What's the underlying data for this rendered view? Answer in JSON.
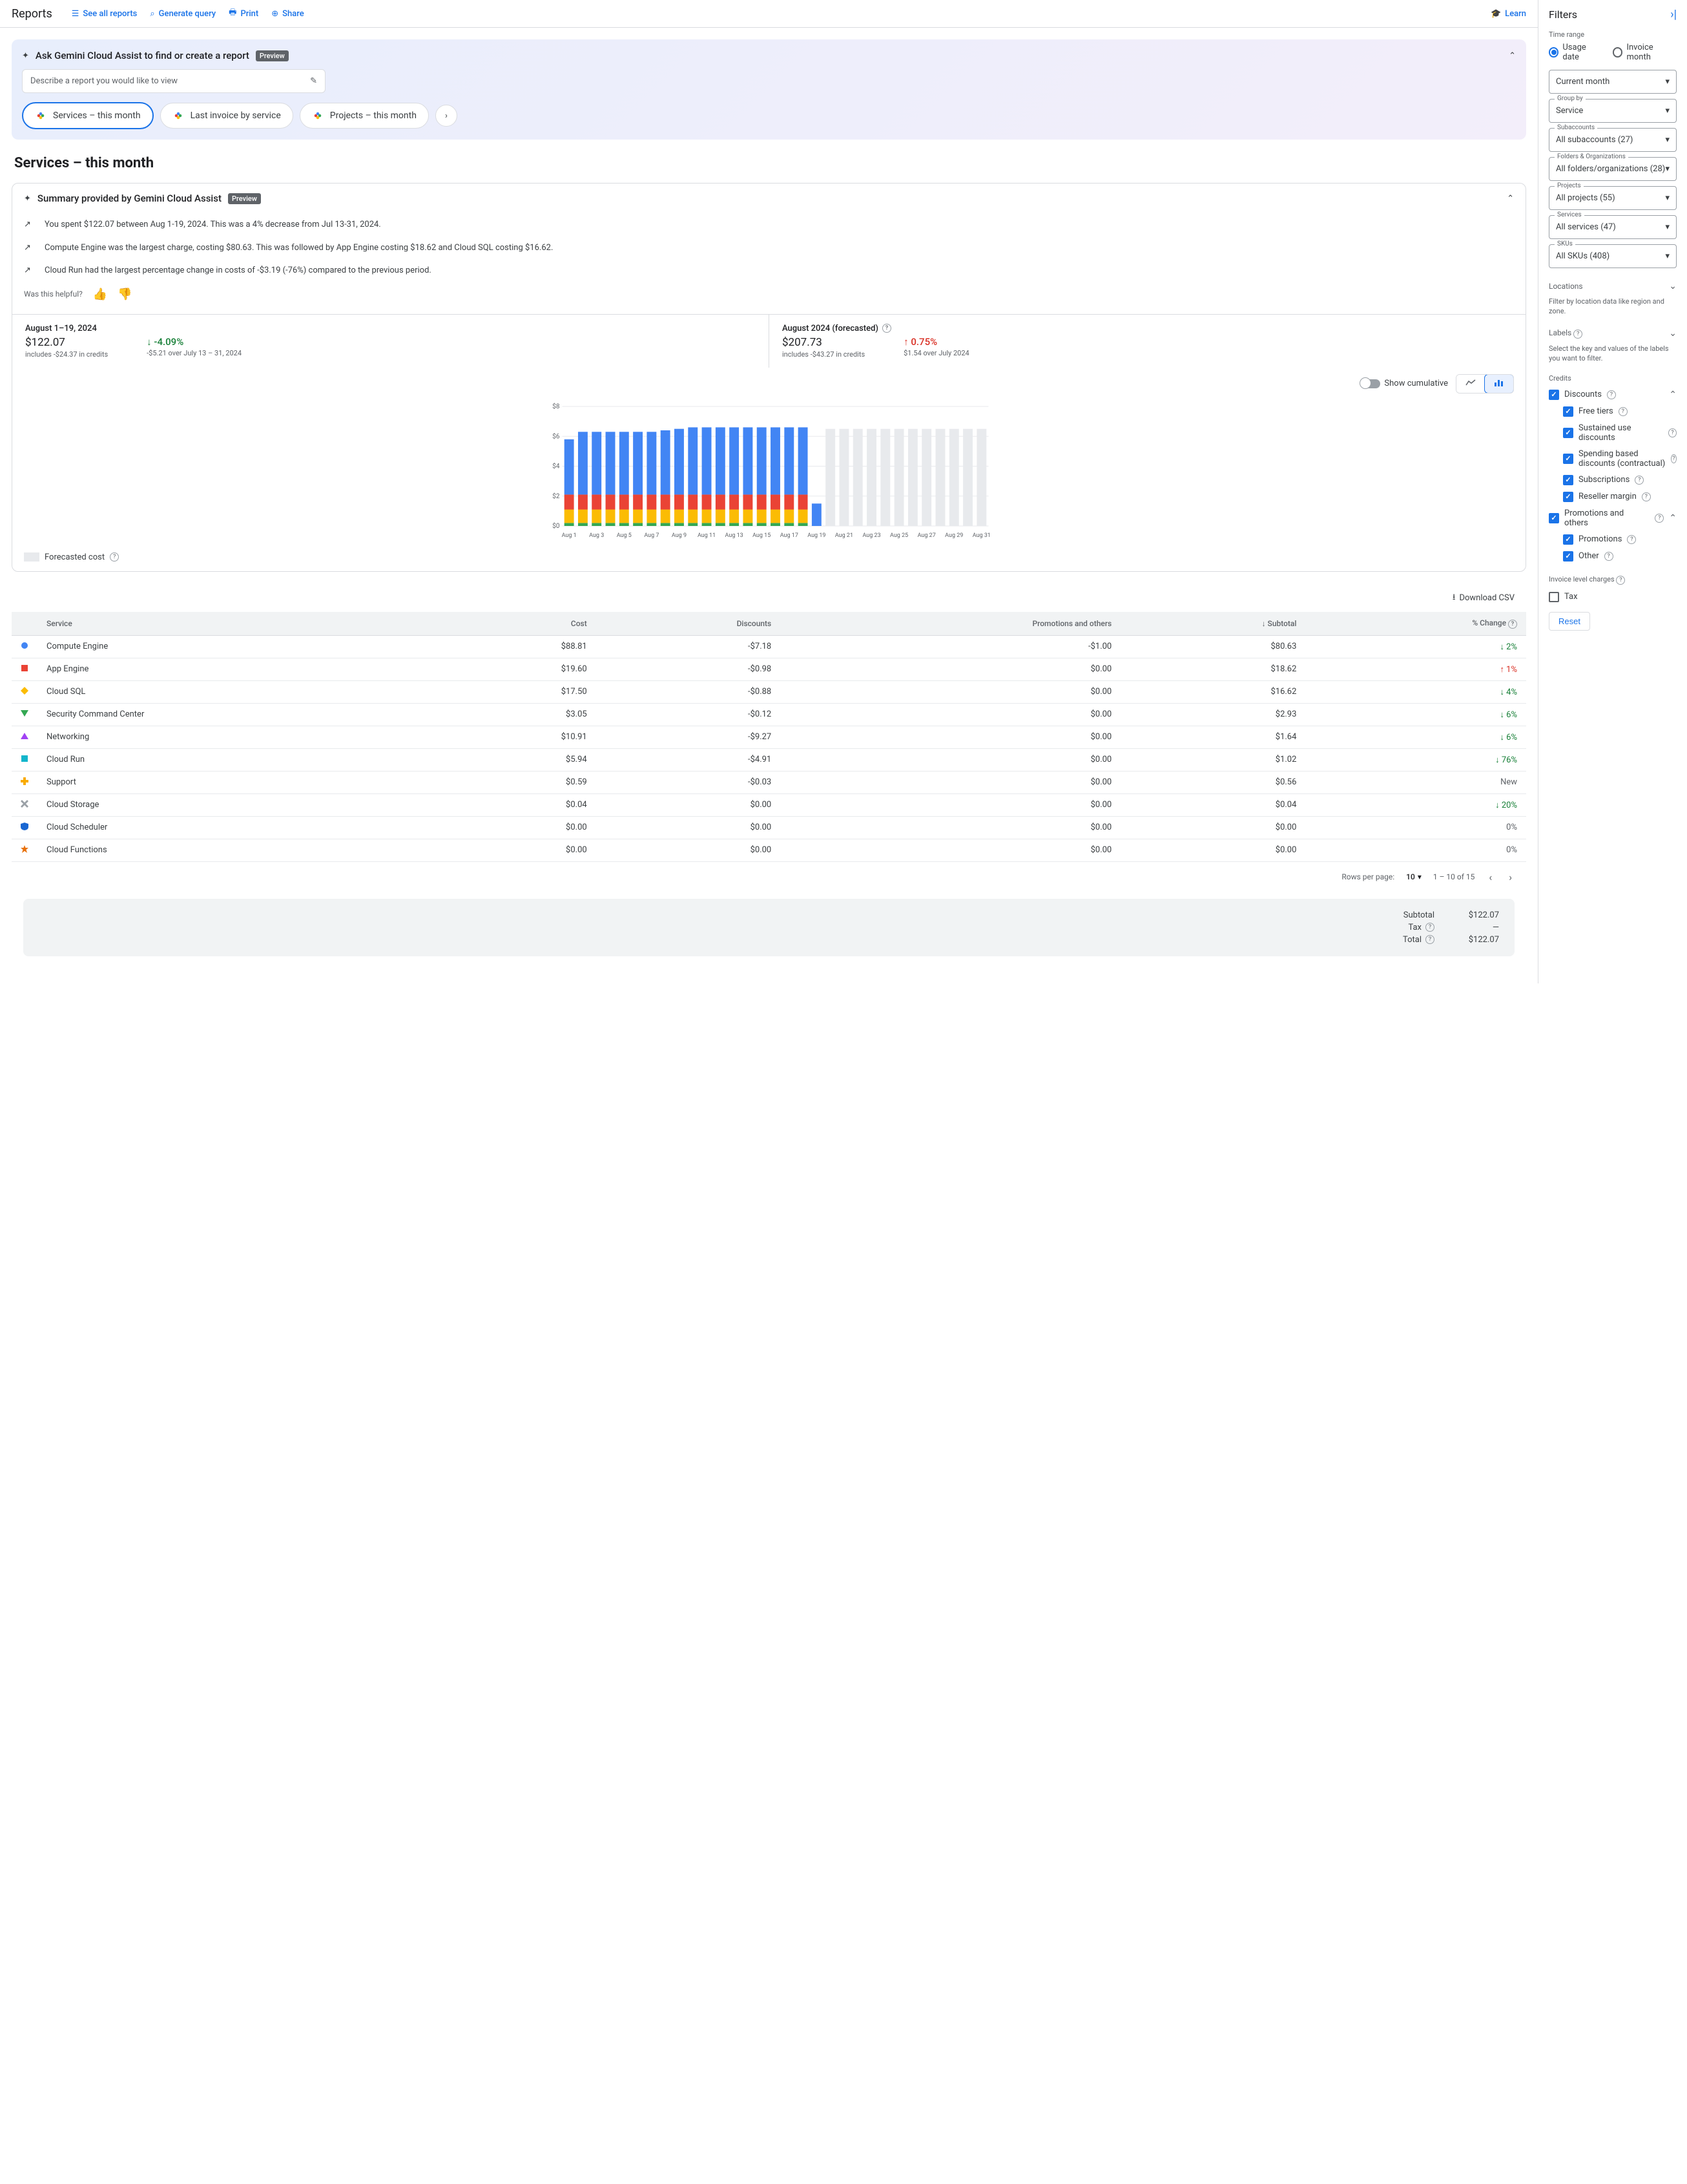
{
  "header": {
    "title": "Reports",
    "links": {
      "see_all": "See all reports",
      "generate": "Generate query",
      "print": "Print",
      "share": "Share",
      "learn": "Learn"
    }
  },
  "gemini": {
    "title": "Ask Gemini Cloud Assist to find or create a report",
    "badge": "Preview",
    "placeholder": "Describe a report you would like to view",
    "chips": [
      "Services – this month",
      "Last invoice by service",
      "Projects – this month"
    ]
  },
  "report": {
    "title": "Services – this month"
  },
  "summary": {
    "title": "Summary provided by Gemini Cloud Assist",
    "badge": "Preview",
    "items": [
      "You spent $122.07 between Aug 1-19, 2024. This was a 4% decrease from Jul 13-31, 2024.",
      "Compute Engine was the largest charge, costing $80.63. This was followed by App Engine costing $18.62 and Cloud SQL costing $16.62.",
      "Cloud Run had the largest percentage change in costs of -$3.19 (-76%) compared to the previous period."
    ],
    "helpful": "Was this helpful?"
  },
  "cost": {
    "actual": {
      "date": "August 1–19, 2024",
      "amount": "$122.07",
      "credits": "includes -$24.37 in credits",
      "change": "-4.09%",
      "change_sub": "-$5.21 over July 13 – 31, 2024"
    },
    "forecast": {
      "date": "August 2024 (forecasted)",
      "amount": "$207.73",
      "credits": "includes -$43.27 in credits",
      "change": "0.75%",
      "change_sub": "$1.54 over July 2024"
    }
  },
  "chart_controls": {
    "cumulative": "Show cumulative"
  },
  "chart_data": {
    "type": "bar",
    "ylabel": "$",
    "ylim": [
      0,
      8
    ],
    "yticks": [
      0,
      2,
      4,
      6,
      8
    ],
    "categories": [
      "Aug 1",
      "Aug 2",
      "Aug 3",
      "Aug 4",
      "Aug 5",
      "Aug 6",
      "Aug 7",
      "Aug 8",
      "Aug 9",
      "Aug 10",
      "Aug 11",
      "Aug 12",
      "Aug 13",
      "Aug 14",
      "Aug 15",
      "Aug 16",
      "Aug 17",
      "Aug 18",
      "Aug 19",
      "Aug 20",
      "Aug 21",
      "Aug 22",
      "Aug 23",
      "Aug 24",
      "Aug 25",
      "Aug 26",
      "Aug 27",
      "Aug 28",
      "Aug 29",
      "Aug 30",
      "Aug 31"
    ],
    "xlabels": [
      "Aug 1",
      "Aug 3",
      "Aug 5",
      "Aug 7",
      "Aug 9",
      "Aug 11",
      "Aug 13",
      "Aug 15",
      "Aug 17",
      "Aug 19",
      "Aug 21",
      "Aug 23",
      "Aug 25",
      "Aug 27",
      "Aug 29",
      "Aug 31"
    ],
    "series": [
      {
        "name": "Compute Engine",
        "color": "#4285f4",
        "values": [
          3.7,
          4.2,
          4.2,
          4.2,
          4.2,
          4.2,
          4.2,
          4.3,
          4.4,
          4.5,
          4.5,
          4.5,
          4.5,
          4.5,
          4.5,
          4.5,
          4.5,
          4.5,
          1.5
        ]
      },
      {
        "name": "App Engine",
        "color": "#ea4335",
        "values": [
          1.0,
          1.0,
          1.0,
          1.0,
          1.0,
          1.0,
          1.0,
          1.0,
          1.0,
          1.0,
          1.0,
          1.0,
          1.0,
          1.0,
          1.0,
          1.0,
          1.0,
          1.0,
          0.0
        ]
      },
      {
        "name": "Cloud SQL",
        "color": "#fbbc04",
        "values": [
          0.9,
          0.9,
          0.9,
          0.9,
          0.9,
          0.9,
          0.9,
          0.9,
          0.9,
          0.9,
          0.9,
          0.9,
          0.9,
          0.9,
          0.9,
          0.9,
          0.9,
          0.9,
          0.0
        ]
      },
      {
        "name": "Other",
        "color": "#34a853",
        "values": [
          0.2,
          0.2,
          0.2,
          0.2,
          0.2,
          0.2,
          0.2,
          0.2,
          0.2,
          0.2,
          0.2,
          0.2,
          0.2,
          0.2,
          0.2,
          0.2,
          0.2,
          0.2,
          0.0
        ]
      }
    ],
    "forecast_values": [
      6.5,
      6.5,
      6.5,
      6.5,
      6.5,
      6.5,
      6.5,
      6.5,
      6.5,
      6.5,
      6.5,
      6.5
    ],
    "forecast_legend": "Forecasted cost"
  },
  "download": "Download CSV",
  "table": {
    "columns": [
      "Service",
      "Cost",
      "Discounts",
      "Promotions and others",
      "Subtotal",
      "% Change"
    ],
    "rows": [
      {
        "marker": "circle",
        "color": "#4285f4",
        "service": "Compute Engine",
        "cost": "$88.81",
        "discounts": "-$7.18",
        "promo": "-$1.00",
        "subtotal": "$80.63",
        "change": "2%",
        "dir": "down"
      },
      {
        "marker": "square",
        "color": "#ea4335",
        "service": "App Engine",
        "cost": "$19.60",
        "discounts": "-$0.98",
        "promo": "$0.00",
        "subtotal": "$18.62",
        "change": "1%",
        "dir": "up"
      },
      {
        "marker": "diamond",
        "color": "#fbbc04",
        "service": "Cloud SQL",
        "cost": "$17.50",
        "discounts": "-$0.88",
        "promo": "$0.00",
        "subtotal": "$16.62",
        "change": "4%",
        "dir": "down"
      },
      {
        "marker": "tri-down",
        "color": "#34a853",
        "service": "Security Command Center",
        "cost": "$3.05",
        "discounts": "-$0.12",
        "promo": "$0.00",
        "subtotal": "$2.93",
        "change": "6%",
        "dir": "down"
      },
      {
        "marker": "tri-up",
        "color": "#a142f4",
        "service": "Networking",
        "cost": "$10.91",
        "discounts": "-$9.27",
        "promo": "$0.00",
        "subtotal": "$1.64",
        "change": "6%",
        "dir": "down"
      },
      {
        "marker": "square",
        "color": "#12b5cb",
        "service": "Cloud Run",
        "cost": "$5.94",
        "discounts": "-$4.91",
        "promo": "$0.00",
        "subtotal": "$1.02",
        "change": "76%",
        "dir": "down"
      },
      {
        "marker": "plus",
        "color": "#f9ab00",
        "service": "Support",
        "cost": "$0.59",
        "discounts": "-$0.03",
        "promo": "$0.00",
        "subtotal": "$0.56",
        "change": "New",
        "dir": "none"
      },
      {
        "marker": "x",
        "color": "#9aa0a6",
        "service": "Cloud Storage",
        "cost": "$0.04",
        "discounts": "$0.00",
        "promo": "$0.00",
        "subtotal": "$0.04",
        "change": "20%",
        "dir": "down"
      },
      {
        "marker": "shield",
        "color": "#1967d2",
        "service": "Cloud Scheduler",
        "cost": "$0.00",
        "discounts": "$0.00",
        "promo": "$0.00",
        "subtotal": "$0.00",
        "change": "0%",
        "dir": "none"
      },
      {
        "marker": "star",
        "color": "#e8710a",
        "service": "Cloud Functions",
        "cost": "$0.00",
        "discounts": "$0.00",
        "promo": "$0.00",
        "subtotal": "$0.00",
        "change": "0%",
        "dir": "none"
      }
    ]
  },
  "pagination": {
    "rows_label": "Rows per page:",
    "rows_value": "10",
    "range": "1 – 10 of 15"
  },
  "totals": {
    "subtotal_label": "Subtotal",
    "subtotal_value": "$122.07",
    "tax_label": "Tax",
    "tax_value": "—",
    "total_label": "Total",
    "total_value": "$122.07"
  },
  "filters": {
    "title": "Filters",
    "time_range_label": "Time range",
    "radio_usage": "Usage date",
    "radio_invoice": "Invoice month",
    "current_month": "Current month",
    "group_by_label": "Group by",
    "group_by_value": "Service",
    "subaccounts_label": "Subaccounts",
    "subaccounts_value": "All subaccounts (27)",
    "folders_label": "Folders & Organizations",
    "folders_value": "All folders/organizations (28)",
    "projects_label": "Projects",
    "projects_value": "All projects (55)",
    "services_label": "Services",
    "services_value": "All services (47)",
    "skus_label": "SKUs",
    "skus_value": "All SKUs (408)",
    "locations_label": "Locations",
    "locations_help": "Filter by location data like region and zone.",
    "labels_label": "Labels",
    "labels_help": "Select the key and values of the labels you want to filter.",
    "credits_label": "Credits",
    "credits": {
      "discounts": "Discounts",
      "free_tiers": "Free tiers",
      "sustained": "Sustained use discounts",
      "spending": "Spending based discounts (contractual)",
      "subscriptions": "Subscriptions",
      "reseller": "Reseller margin",
      "promotions_others": "Promotions and others",
      "promotions": "Promotions",
      "other": "Other"
    },
    "invoice_level_label": "Invoice level charges",
    "tax_checkbox": "Tax",
    "reset": "Reset"
  }
}
